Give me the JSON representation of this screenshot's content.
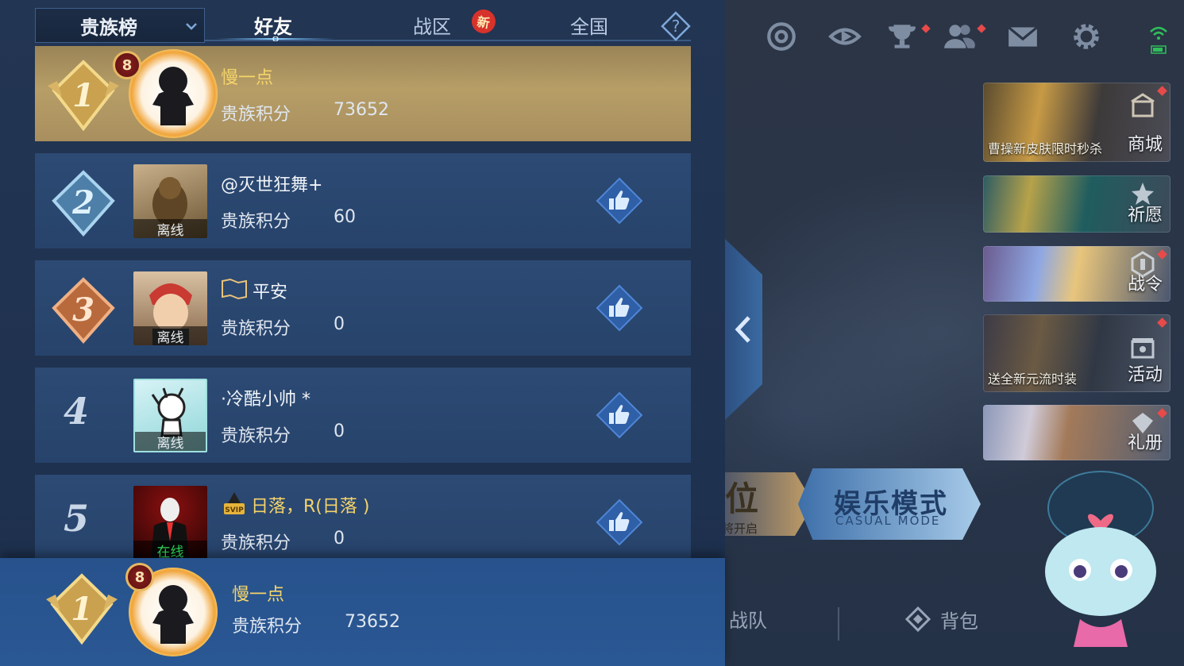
{
  "header": {
    "dropdown_label": "贵族榜",
    "tabs": [
      {
        "label": "好友",
        "active": true
      },
      {
        "label": "战区",
        "active": false,
        "badge": "新"
      },
      {
        "label": "全国",
        "active": false
      }
    ],
    "help_icon": "question-diamond-icon"
  },
  "leaderboard": {
    "score_label": "贵族积分",
    "rows": [
      {
        "rank": "1",
        "name": "慢一点",
        "score": "73652",
        "vip_level": "8",
        "status": "",
        "like": false
      },
      {
        "rank": "2",
        "name": "@灭世狂舞+",
        "score": "60",
        "status": "离线",
        "like": true
      },
      {
        "rank": "3",
        "name": "平安",
        "score": "0",
        "status": "离线",
        "like": true
      },
      {
        "rank": "4",
        "name": "·冷酷小帅 *",
        "score": "0",
        "status": "离线",
        "like": true
      },
      {
        "rank": "5",
        "name": "日落，R(日落 )",
        "score": "0",
        "status": "在线",
        "like": true,
        "vip_tag": "SVIP"
      }
    ]
  },
  "my_rank": {
    "rank": "1",
    "name": "慢一点",
    "score_label": "贵族积分",
    "score": "73652",
    "vip_level": "8"
  },
  "side_menu": [
    {
      "label": "商城",
      "sub": "曹操新皮肤限时秒杀",
      "icon": "shop-icon"
    },
    {
      "label": "祈愿",
      "sub": "",
      "icon": "wish-icon"
    },
    {
      "label": "战令",
      "sub": "",
      "icon": "battle-pass-icon"
    },
    {
      "label": "活动",
      "sub": "送全新元流时装",
      "icon": "event-icon"
    },
    {
      "label": "礼册",
      "sub": "",
      "icon": "gift-book-icon"
    }
  ],
  "mode": {
    "ranked_text": "位",
    "ranked_sub": "将开启",
    "casual_title": "娱乐模式",
    "casual_sub": "CASUAL MODE"
  },
  "bottom": {
    "team_label": "战队",
    "bag_label": "背包"
  },
  "colors": {
    "panel_bg": "#223552",
    "row_bg": "#2c4a74",
    "first_row_gold": "#b79e67",
    "my_row_bg": "#27528c",
    "name_gold": "#f5d46a",
    "online_green": "#2fe05c"
  }
}
